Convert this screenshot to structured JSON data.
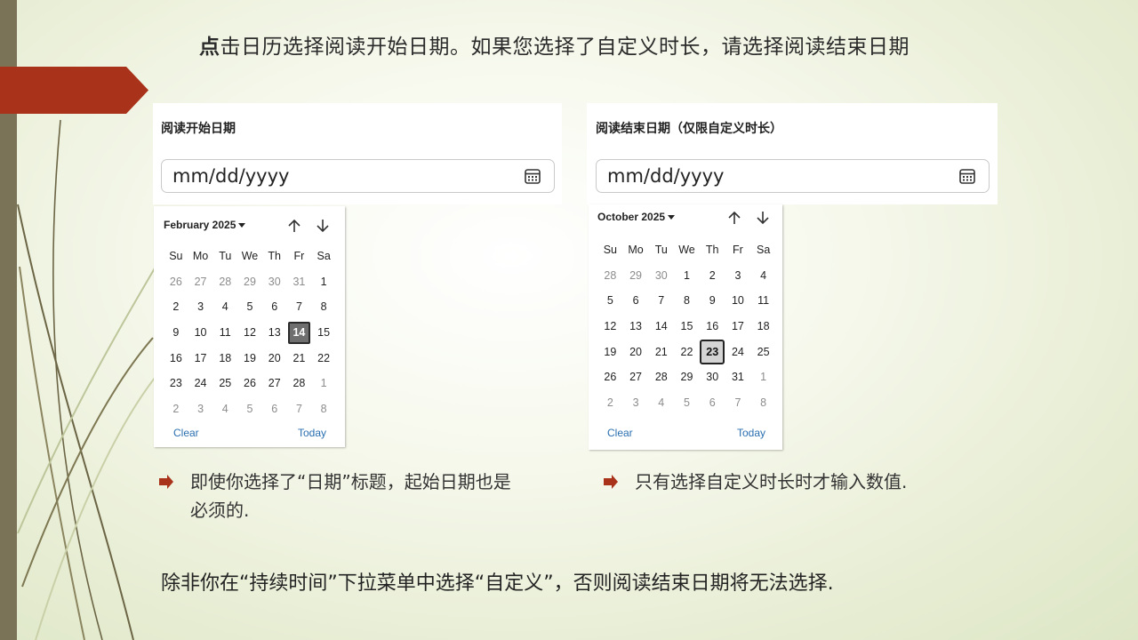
{
  "slide": {
    "title_bold": "点",
    "title_rest": "击日历选择阅读开始日期。如果您选择了自定义时长，请选择阅读结束日期",
    "bottom_text": "除非你在“持续时间”下拉菜单中选择“自定义”，否则阅读结束日期将无法选择."
  },
  "start_field": {
    "label": "阅读开始日期",
    "placeholder": "mm/dd/yyyy",
    "icon": "calendar-icon"
  },
  "end_field": {
    "label": "阅读结束日期（仅限自定义时长）",
    "placeholder": "mm/dd/yyyy",
    "icon": "calendar-icon"
  },
  "weekdays": [
    "Su",
    "Mo",
    "Tu",
    "We",
    "Th",
    "Fr",
    "Sa"
  ],
  "start_calendar": {
    "month_label": "February 2025",
    "up_icon": "arrow-up-icon",
    "down_icon": "arrow-down-icon",
    "days": [
      [
        "26",
        "27",
        "28",
        "29",
        "30",
        "31",
        "1"
      ],
      [
        "2",
        "3",
        "4",
        "5",
        "6",
        "7",
        "8"
      ],
      [
        "9",
        "10",
        "11",
        "12",
        "13",
        "14",
        "15"
      ],
      [
        "16",
        "17",
        "18",
        "19",
        "20",
        "21",
        "22"
      ],
      [
        "23",
        "24",
        "25",
        "26",
        "27",
        "28",
        "1"
      ],
      [
        "2",
        "3",
        "4",
        "5",
        "6",
        "7",
        "8"
      ]
    ],
    "selected": "14",
    "clear_label": "Clear",
    "today_label": "Today"
  },
  "end_calendar": {
    "month_label": "October 2025",
    "up_icon": "arrow-up-icon",
    "down_icon": "arrow-down-icon",
    "days": [
      [
        "28",
        "29",
        "30",
        "1",
        "2",
        "3",
        "4"
      ],
      [
        "5",
        "6",
        "7",
        "8",
        "9",
        "10",
        "11"
      ],
      [
        "12",
        "13",
        "14",
        "15",
        "16",
        "17",
        "18"
      ],
      [
        "19",
        "20",
        "21",
        "22",
        "23",
        "24",
        "25"
      ],
      [
        "26",
        "27",
        "28",
        "29",
        "30",
        "31",
        "1"
      ],
      [
        "2",
        "3",
        "4",
        "5",
        "6",
        "7",
        "8"
      ]
    ],
    "selected": "23",
    "clear_label": "Clear",
    "today_label": "Today"
  },
  "bullets": [
    {
      "text": "即使你选择了“日期”标题，起始日期也是必须的."
    },
    {
      "text": "只有选择自定义时长时才输入数值."
    }
  ],
  "colors": {
    "accent_red": "#a8321a",
    "sidebar": "#7b7358",
    "link_blue": "#2a6fb0"
  }
}
